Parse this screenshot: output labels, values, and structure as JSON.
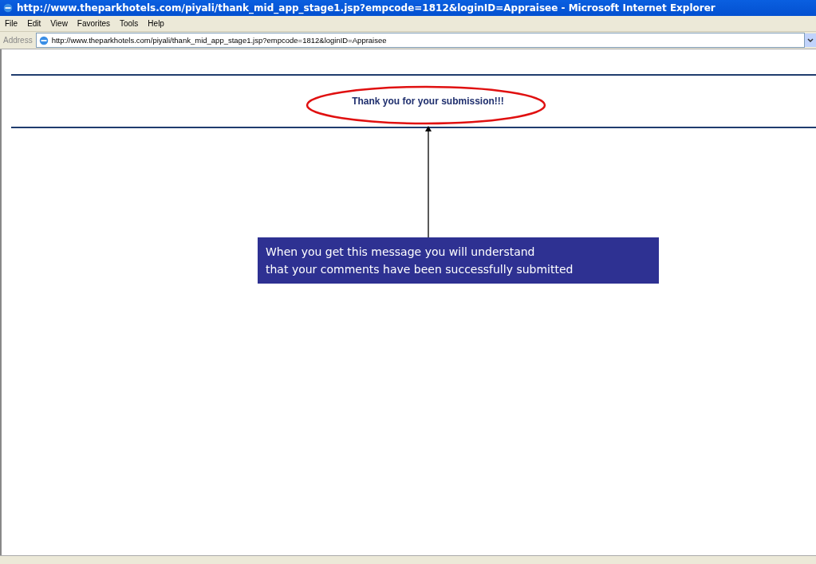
{
  "window": {
    "title": "http://www.theparkhotels.com/piyali/thank_mid_app_stage1.jsp?empcode=1812&loginID=Appraisee - Microsoft Internet Explorer"
  },
  "menu": [
    "File",
    "Edit",
    "View",
    "Favorites",
    "Tools",
    "Help"
  ],
  "address_bar": {
    "label": "Address",
    "value": "http://www.theparkhotels.com/piyali/thank_mid_app_stage1.jsp?empcode=1812&loginID=Appraisee"
  },
  "page": {
    "message": "Thank you for your submission!!!"
  },
  "callout": {
    "lines": [
      "When you get this message you will understand",
      "that your comments have been successfully submitted"
    ]
  }
}
